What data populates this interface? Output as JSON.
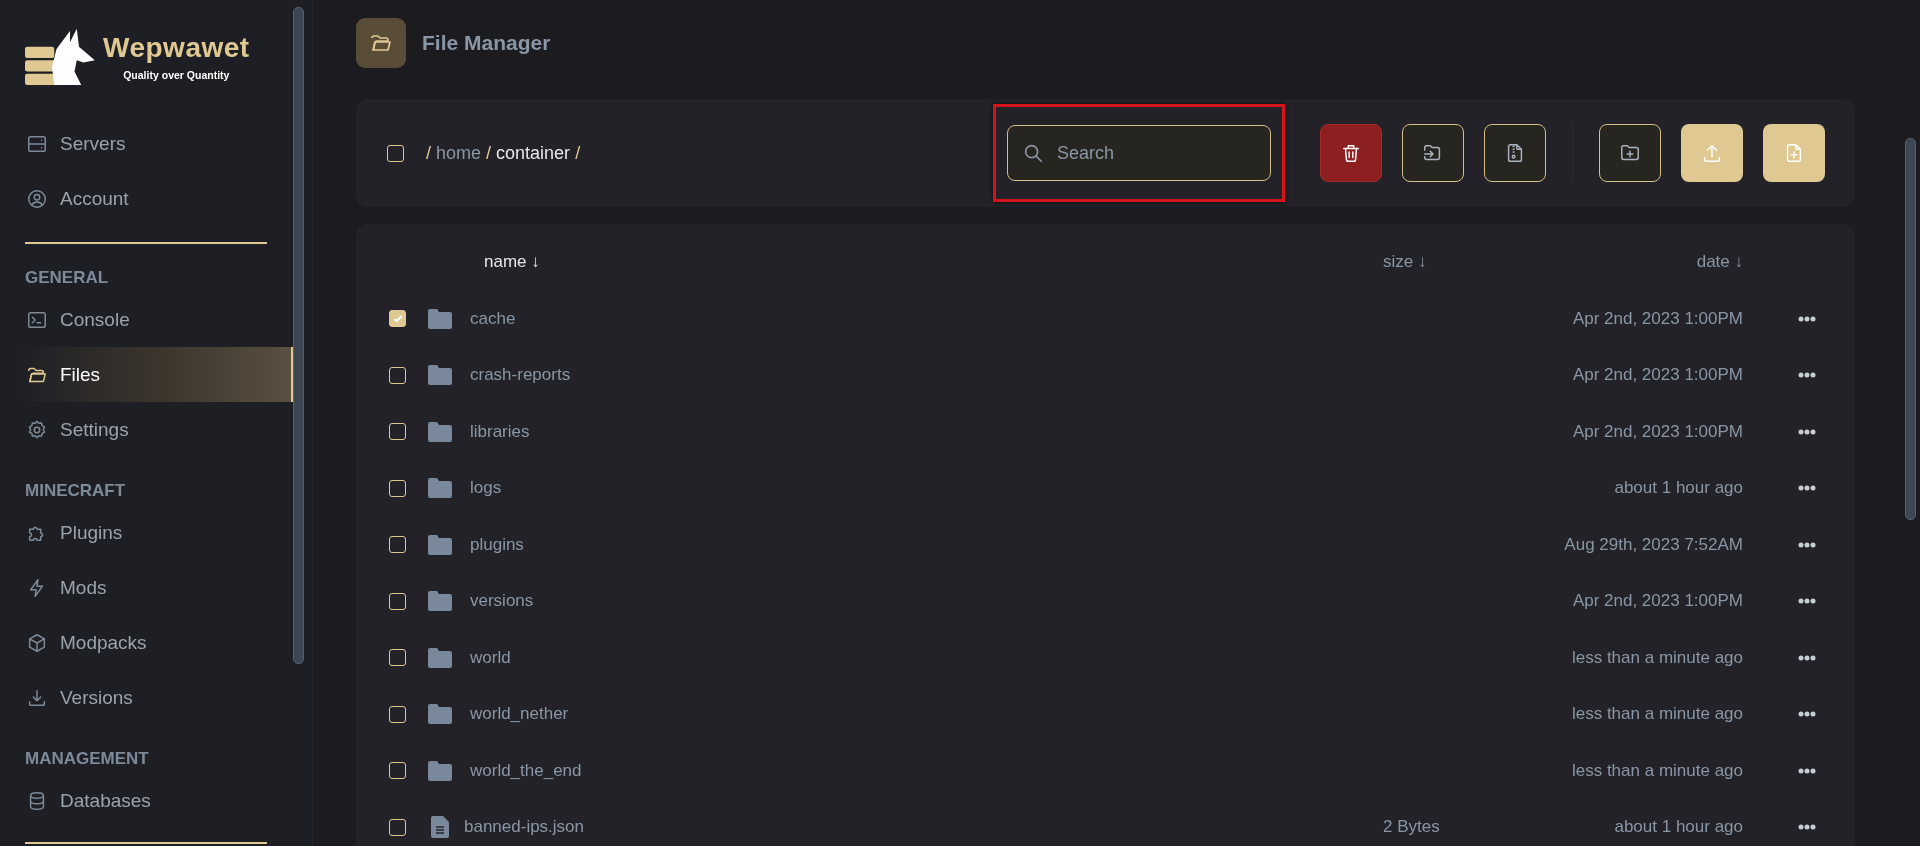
{
  "brand": {
    "name": "Wepwawet",
    "tagline": "Quality over Quantity"
  },
  "sidebar": {
    "top_items": [
      {
        "label": "Servers",
        "selected": false
      },
      {
        "label": "Account",
        "selected": false
      }
    ],
    "groups": [
      {
        "heading": "GENERAL",
        "items": [
          {
            "label": "Console",
            "selected": false
          },
          {
            "label": "Files",
            "selected": true
          },
          {
            "label": "Settings",
            "selected": false
          }
        ]
      },
      {
        "heading": "MINECRAFT",
        "items": [
          {
            "label": "Plugins",
            "selected": false
          },
          {
            "label": "Mods",
            "selected": false
          },
          {
            "label": "Modpacks",
            "selected": false
          },
          {
            "label": "Versions",
            "selected": false
          }
        ]
      },
      {
        "heading": "MANAGEMENT",
        "items": [
          {
            "label": "Databases",
            "selected": false
          }
        ]
      }
    ]
  },
  "page": {
    "title": "File Manager"
  },
  "toolbar": {
    "select_all_checked": false,
    "separator": "/",
    "path": [
      {
        "label": "home",
        "current": false
      },
      {
        "label": "container",
        "current": true
      }
    ],
    "search": {
      "placeholder": "Search",
      "highlighted": true
    },
    "selection_actions": [
      {
        "kind": "danger"
      },
      {
        "kind": "outline"
      },
      {
        "kind": "outline"
      }
    ],
    "create_actions": [
      {
        "kind": "outline"
      },
      {
        "kind": "filled"
      },
      {
        "kind": "filled"
      }
    ]
  },
  "table": {
    "columns": [
      {
        "label": "name",
        "sort_mark": "↓"
      },
      {
        "label": "size",
        "sort_mark": "↓"
      },
      {
        "label": "date",
        "sort_mark": "↓"
      }
    ],
    "rows": [
      {
        "kind": "folder",
        "name": "cache",
        "size": "",
        "date": "Apr 2nd, 2023 1:00PM",
        "checked": true
      },
      {
        "kind": "folder",
        "name": "crash-reports",
        "size": "",
        "date": "Apr 2nd, 2023 1:00PM",
        "checked": false
      },
      {
        "kind": "folder",
        "name": "libraries",
        "size": "",
        "date": "Apr 2nd, 2023 1:00PM",
        "checked": false
      },
      {
        "kind": "folder",
        "name": "logs",
        "size": "",
        "date": "about 1 hour ago",
        "checked": false
      },
      {
        "kind": "folder",
        "name": "plugins",
        "size": "",
        "date": "Aug 29th, 2023 7:52AM",
        "checked": false
      },
      {
        "kind": "folder",
        "name": "versions",
        "size": "",
        "date": "Apr 2nd, 2023 1:00PM",
        "checked": false
      },
      {
        "kind": "folder",
        "name": "world",
        "size": "",
        "date": "less than a minute ago",
        "checked": false
      },
      {
        "kind": "folder",
        "name": "world_nether",
        "size": "",
        "date": "less than a minute ago",
        "checked": false
      },
      {
        "kind": "folder",
        "name": "world_the_end",
        "size": "",
        "date": "less than a minute ago",
        "checked": false
      },
      {
        "kind": "file",
        "name": "banned-ips.json",
        "size": "2 Bytes",
        "date": "about 1 hour ago",
        "checked": false
      }
    ]
  }
}
